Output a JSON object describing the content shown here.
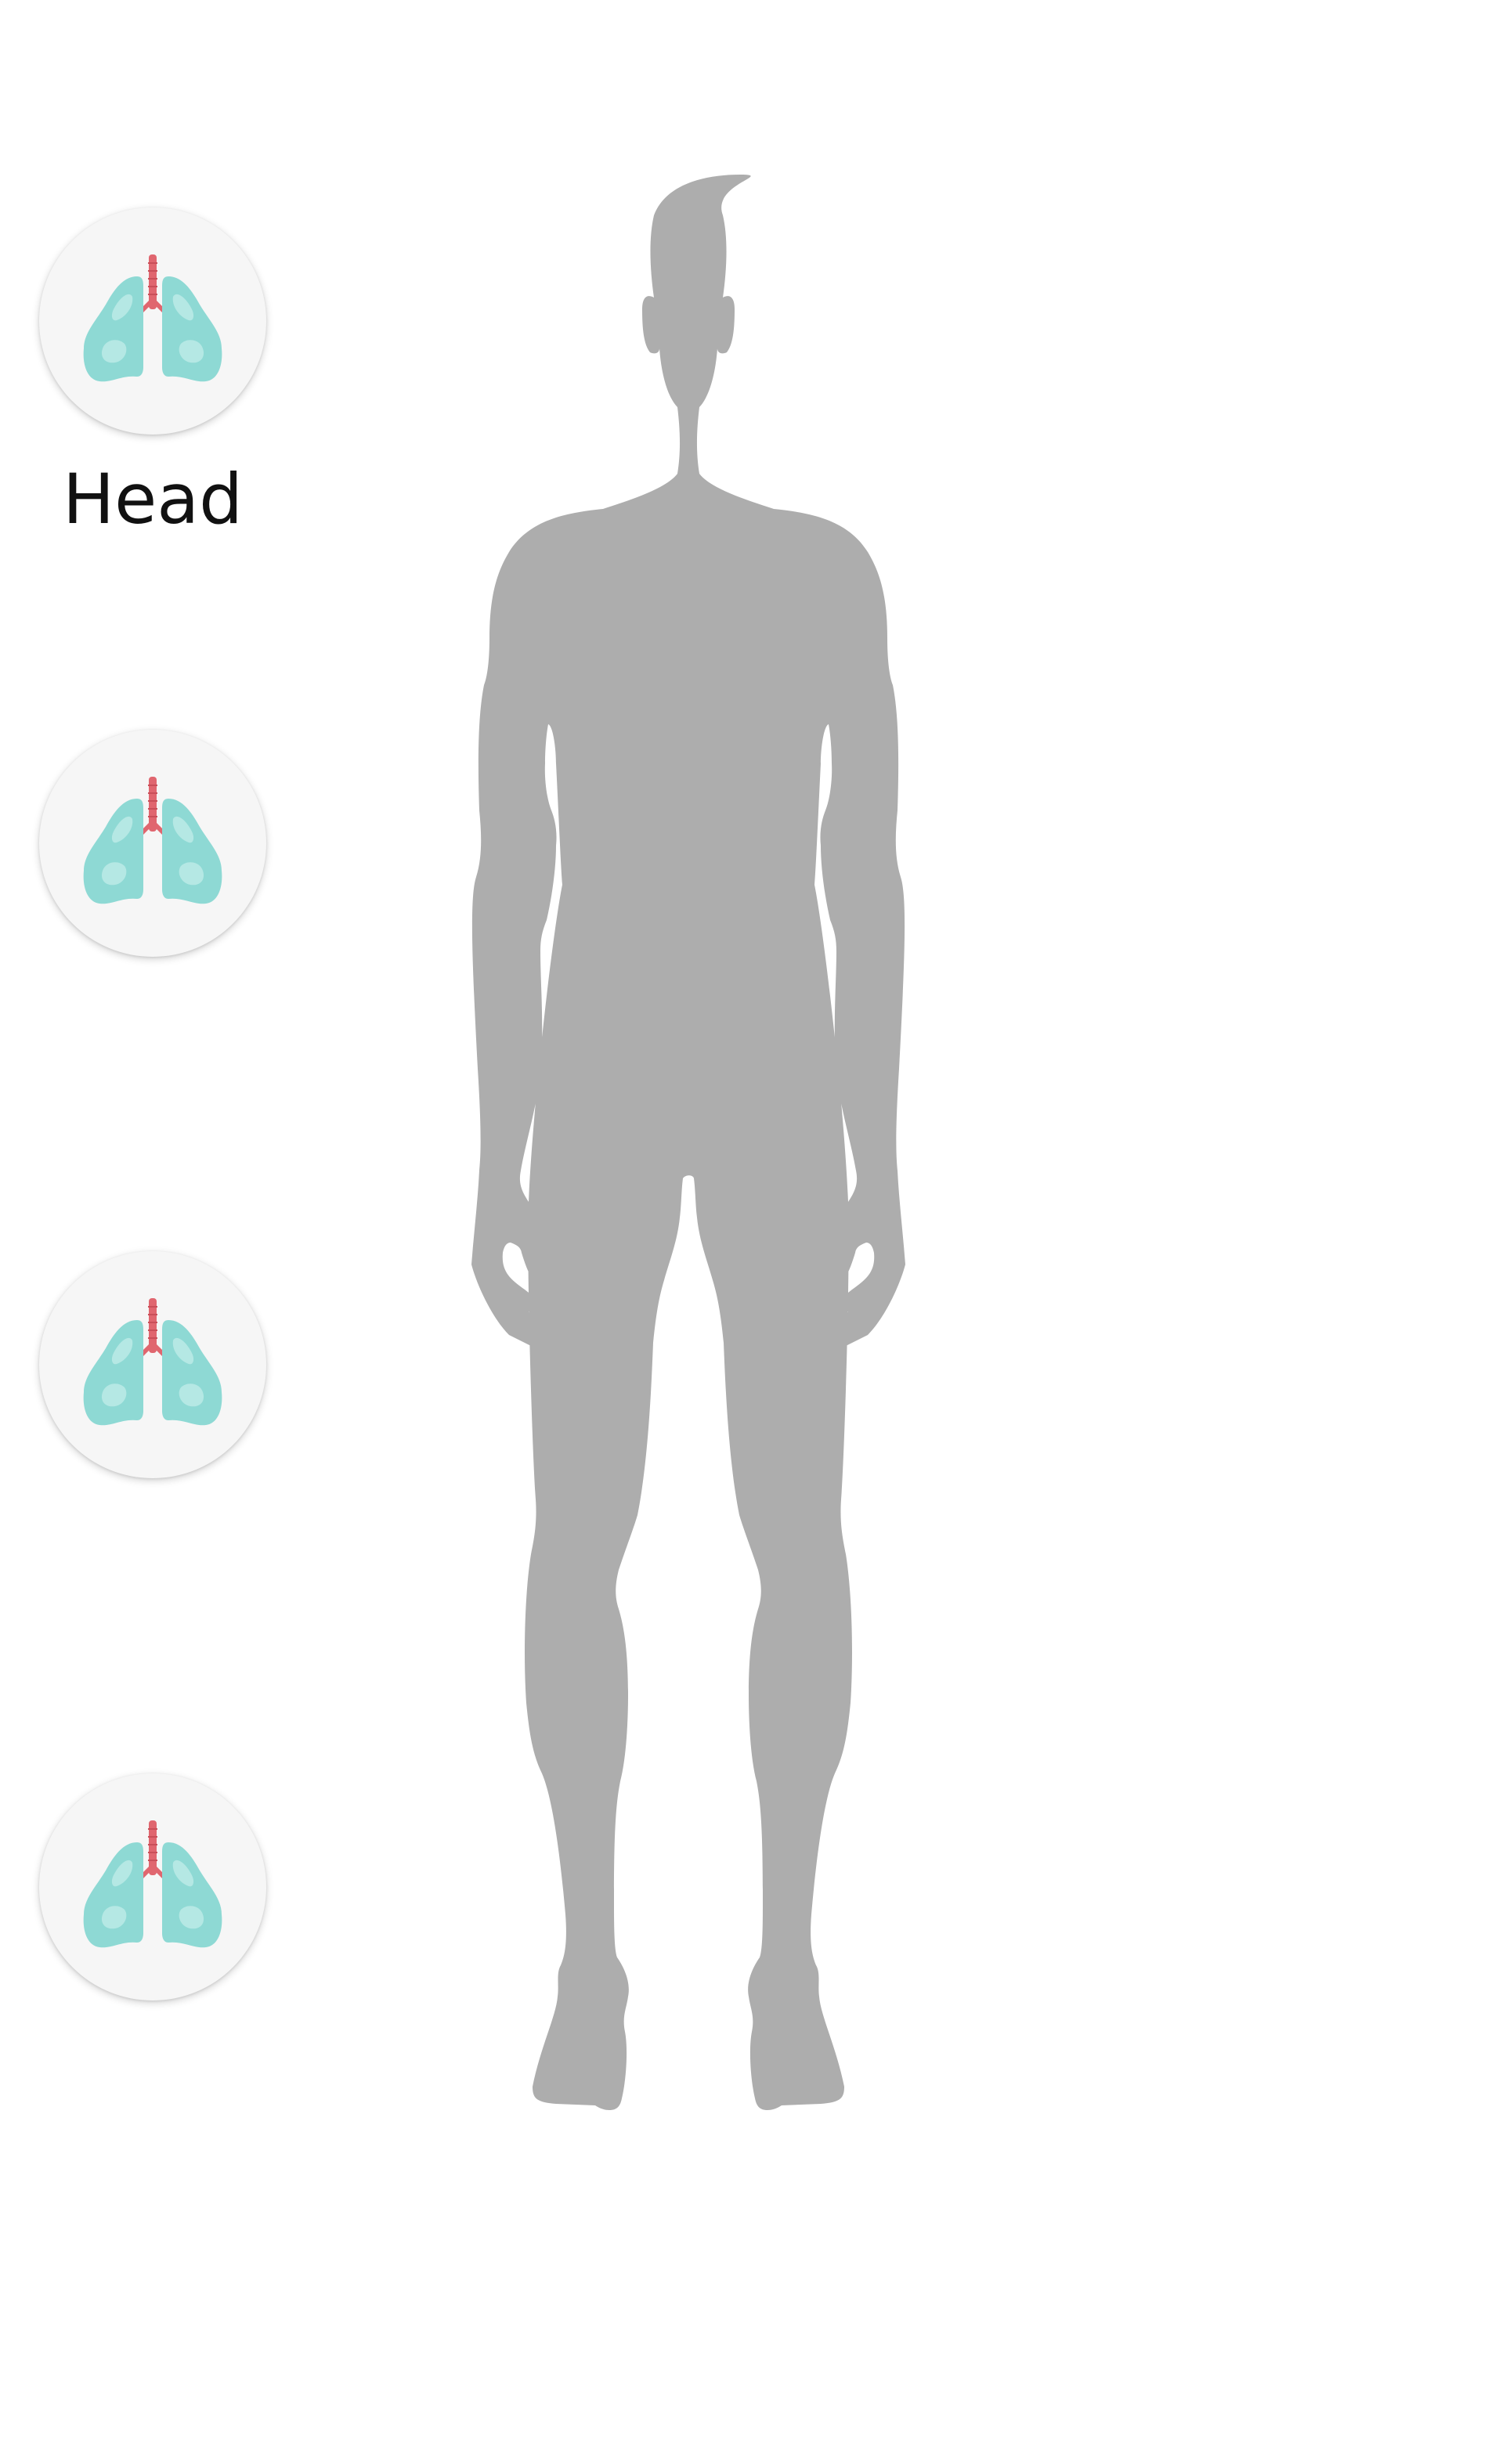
{
  "organs": [
    {
      "label": "Head",
      "icon": "lungs-icon"
    },
    {
      "label": "",
      "icon": "lungs-icon"
    },
    {
      "label": "",
      "icon": "lungs-icon"
    },
    {
      "label": "",
      "icon": "lungs-icon"
    }
  ],
  "figure": {
    "icon": "human-body-silhouette",
    "color": "#adadad"
  },
  "colors": {
    "background": "#ffffff",
    "button_bg": "#f6f6f6",
    "lung": "#8ed9d4",
    "lung_highlight": "#b5e8e4",
    "trachea": "#e0666f"
  }
}
